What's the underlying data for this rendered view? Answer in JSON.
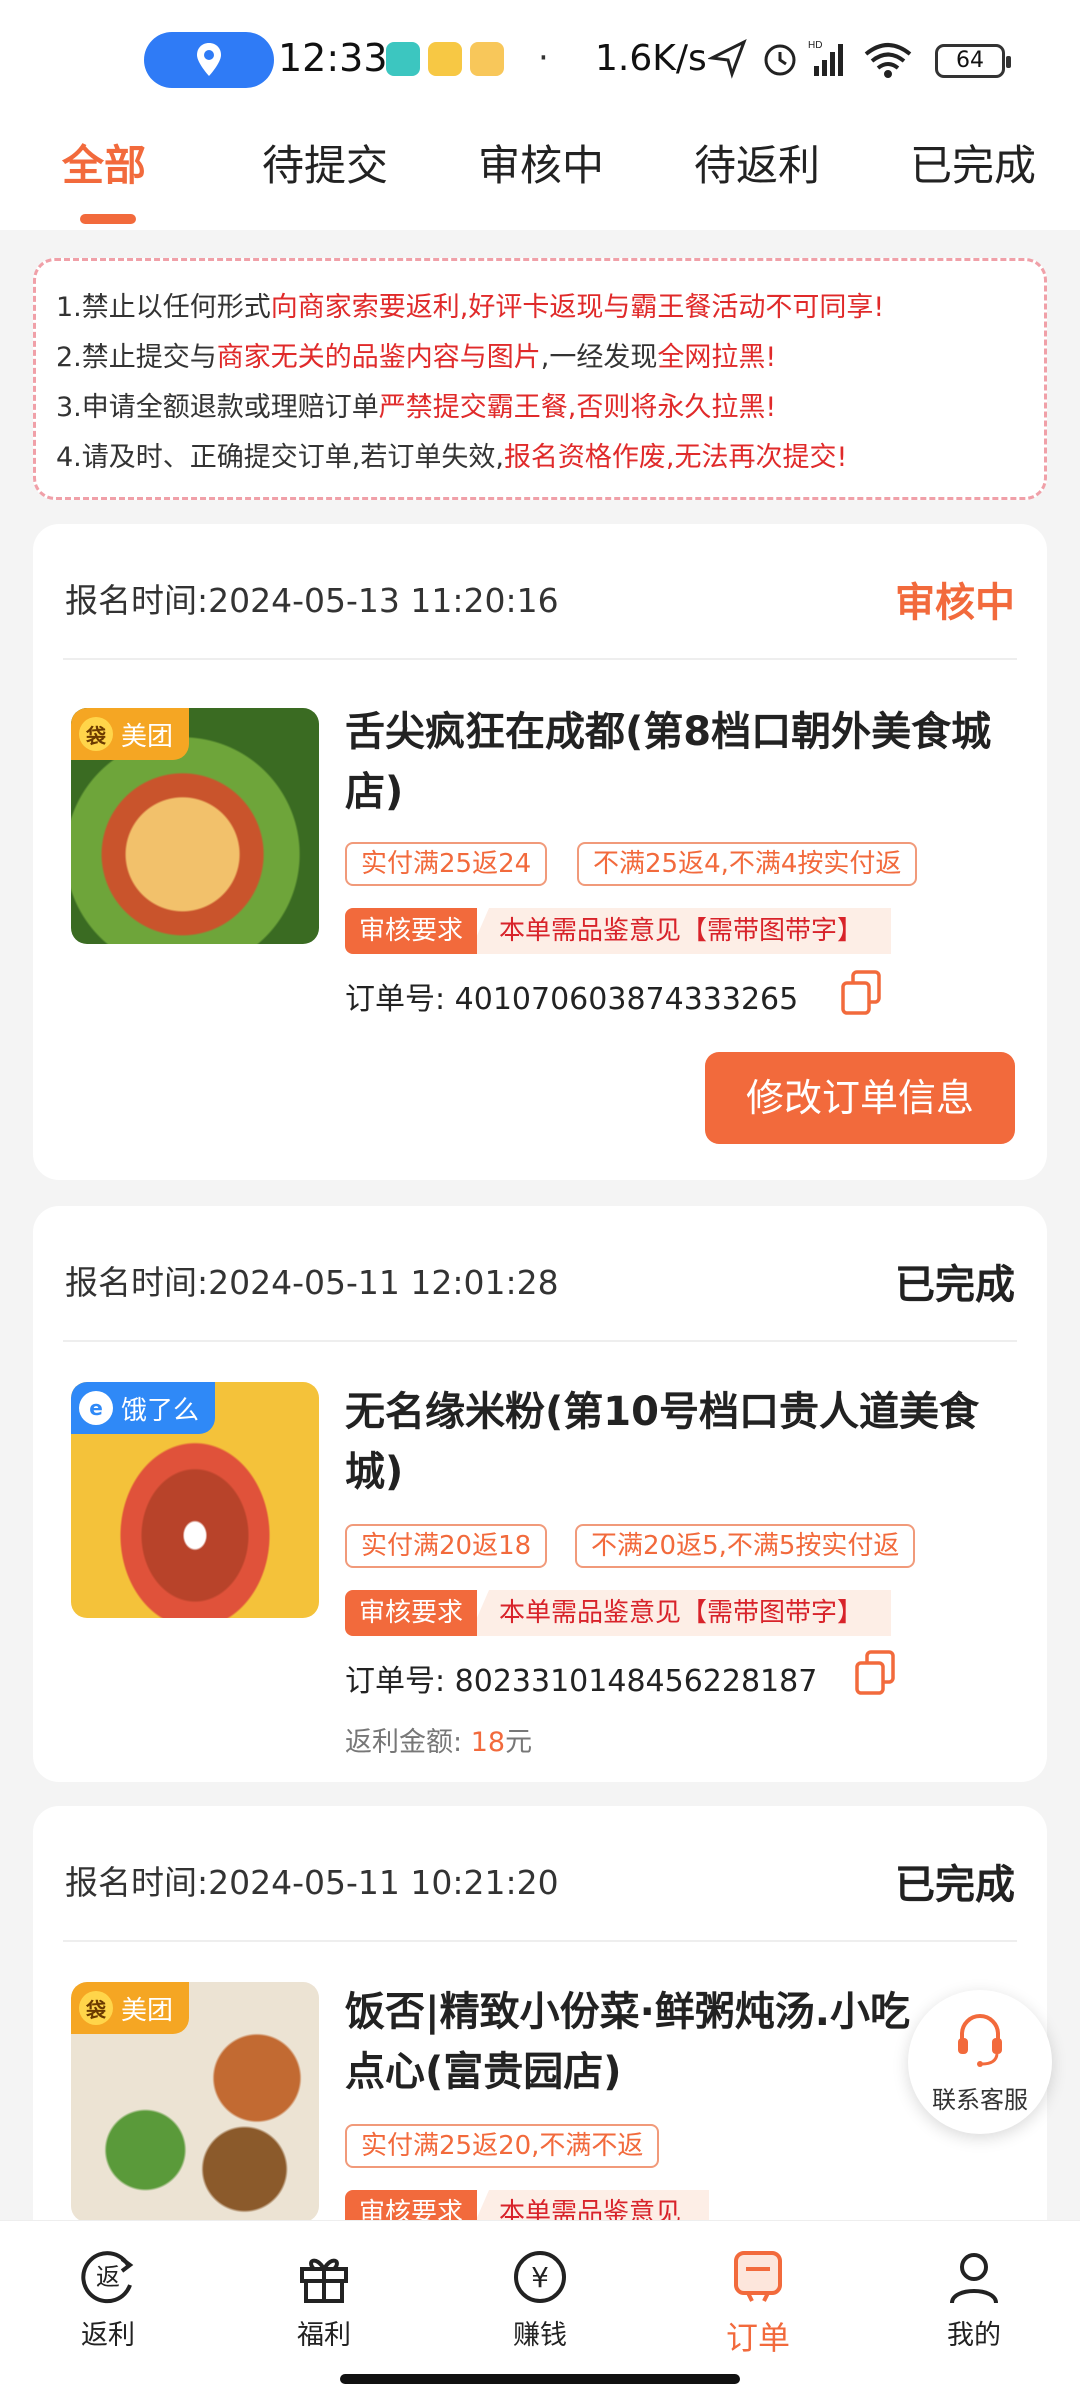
{
  "status_bar": {
    "time": "12:33",
    "speed": "1.6K/s",
    "battery": "64"
  },
  "tabs": [
    {
      "label": "全部",
      "active": true
    },
    {
      "label": "待提交",
      "active": false
    },
    {
      "label": "审核中",
      "active": false
    },
    {
      "label": "待返利",
      "active": false
    },
    {
      "label": "已完成",
      "active": false
    }
  ],
  "notice": {
    "lines": [
      [
        {
          "t": "1.禁止以任何形式",
          "red": false
        },
        {
          "t": "向商家索要返利,好评卡返现与霸王餐活动不可同享!",
          "red": true
        }
      ],
      [
        {
          "t": "2.禁止提交与",
          "red": false
        },
        {
          "t": "商家无关的品鉴内容与图片",
          "red": true
        },
        {
          "t": ",一经发现",
          "red": false
        },
        {
          "t": "全网拉黑!",
          "red": true
        }
      ],
      [
        {
          "t": "3.申请全额退款或理赔订单",
          "red": false
        },
        {
          "t": "严禁提交霸王餐,否则将永久拉黑!",
          "red": true
        }
      ],
      [
        {
          "t": "4.请及时、正确提交订单,若订单失效,",
          "red": false
        },
        {
          "t": "报名资格作废,无法再次提交!",
          "red": true
        }
      ]
    ]
  },
  "orders": [
    {
      "reg_label": "报名时间:",
      "reg_time": "2024-05-13 11:20:16",
      "status": "审核中",
      "platform": "美团",
      "shop_name": "舌尖疯狂在成都(第8档口朝外美食城店)",
      "tags": [
        "实付满25返24",
        "不满25返4,不满4按实付返"
      ],
      "req_label": "审核要求",
      "req_text": "本单需品鉴意见【需带图带字】",
      "order_label": "订单号:",
      "order_no": "401070603874333265",
      "button": "修改订单信息"
    },
    {
      "reg_label": "报名时间:",
      "reg_time": "2024-05-11 12:01:28",
      "status": "已完成",
      "platform": "饿了么",
      "shop_name": "无名缘米粉(第10号档口贵人道美食城)",
      "tags": [
        "实付满20返18",
        "不满20返5,不满5按实付返"
      ],
      "req_label": "审核要求",
      "req_text": "本单需品鉴意见【需带图带字】",
      "order_label": "订单号:",
      "order_no": "802331014845622818​7",
      "rebate_label": "返利金额:",
      "rebate_amount": "18",
      "rebate_unit": "元"
    },
    {
      "reg_label": "报名时间:",
      "reg_time": "2024-05-11 10:21:20",
      "status": "已完成",
      "platform": "美团",
      "shop_name": "饭否|精致小份菜·鲜粥炖汤.小吃点心(富贵园店)",
      "tags": [
        "实付满25返20,不满不返"
      ],
      "req_label": "审核要求",
      "req_text": "本单需品鉴意见"
    }
  ],
  "service": {
    "label": "联系客服"
  },
  "bottom_nav": [
    {
      "label": "返利",
      "icon": "rebate-icon",
      "active": false
    },
    {
      "label": "福利",
      "icon": "gift-icon",
      "active": false
    },
    {
      "label": "赚钱",
      "icon": "yuan-icon",
      "active": false
    },
    {
      "label": "订单",
      "icon": "order-icon",
      "active": true
    },
    {
      "label": "我的",
      "icon": "user-icon",
      "active": false
    }
  ],
  "colors": {
    "accent": "#f26a3c",
    "warning_red": "#e02a2a"
  }
}
